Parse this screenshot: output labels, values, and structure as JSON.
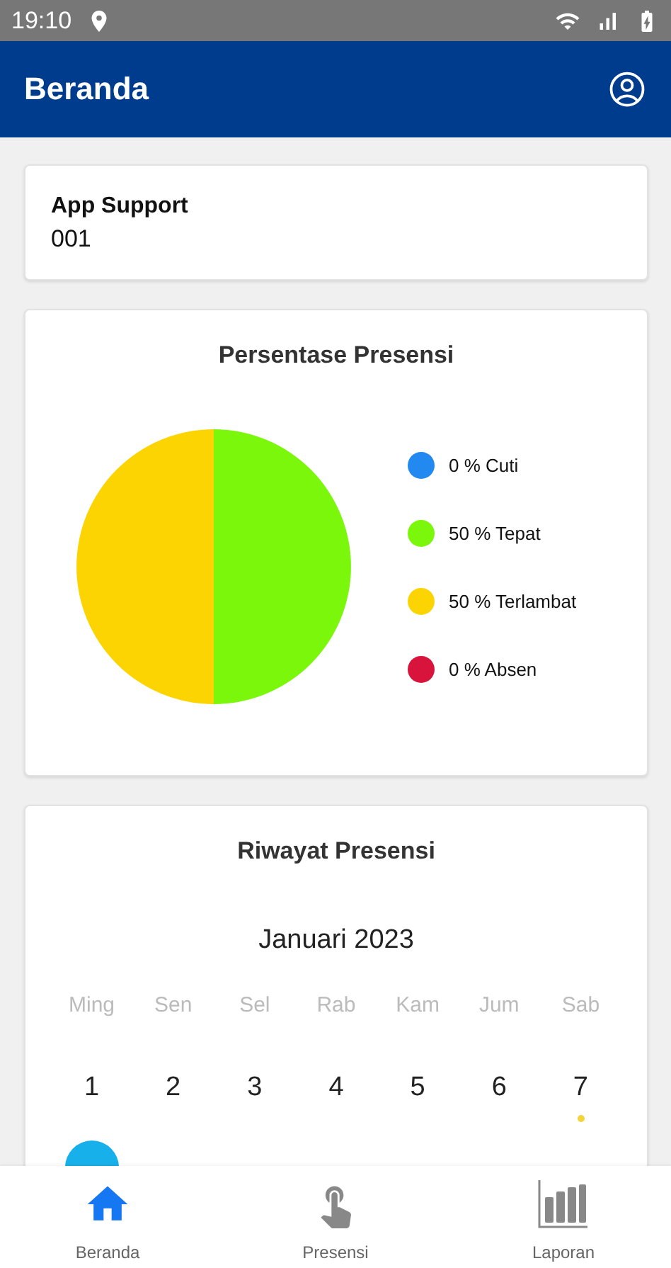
{
  "status_bar": {
    "time": "19:10"
  },
  "app_bar": {
    "title": "Beranda"
  },
  "user_card": {
    "name": "App Support",
    "id": "001"
  },
  "attendance_card": {
    "title": "Persentase Presensi",
    "chart_data": {
      "type": "pie",
      "categories": [
        "0 % Cuti",
        "50 % Tepat",
        "50 % Terlambat",
        "0 % Absen"
      ],
      "values": [
        0,
        50,
        50,
        0
      ],
      "colors": [
        "#2189f0",
        "#7af70a",
        "#fcd402",
        "#d8143c"
      ]
    }
  },
  "history_card": {
    "title": "Riwayat Presensi",
    "month": "Januari 2023",
    "weekdays": [
      "Ming",
      "Sen",
      "Sel",
      "Rab",
      "Kam",
      "Jum",
      "Sab"
    ],
    "days": [
      {
        "label": "1",
        "selected": false
      },
      {
        "label": "2",
        "selected": false
      },
      {
        "label": "3",
        "selected": false
      },
      {
        "label": "4",
        "selected": false
      },
      {
        "label": "5",
        "selected": false
      },
      {
        "label": "6",
        "selected": false
      },
      {
        "label": "7",
        "selected": false,
        "color": "#f3d43a"
      },
      {
        "selected": true
      }
    ]
  },
  "bottom_nav": [
    {
      "label": "Beranda",
      "selected": true
    },
    {
      "label": "Presensi",
      "selected": false
    },
    {
      "label": "Laporan",
      "selected": false
    }
  ]
}
